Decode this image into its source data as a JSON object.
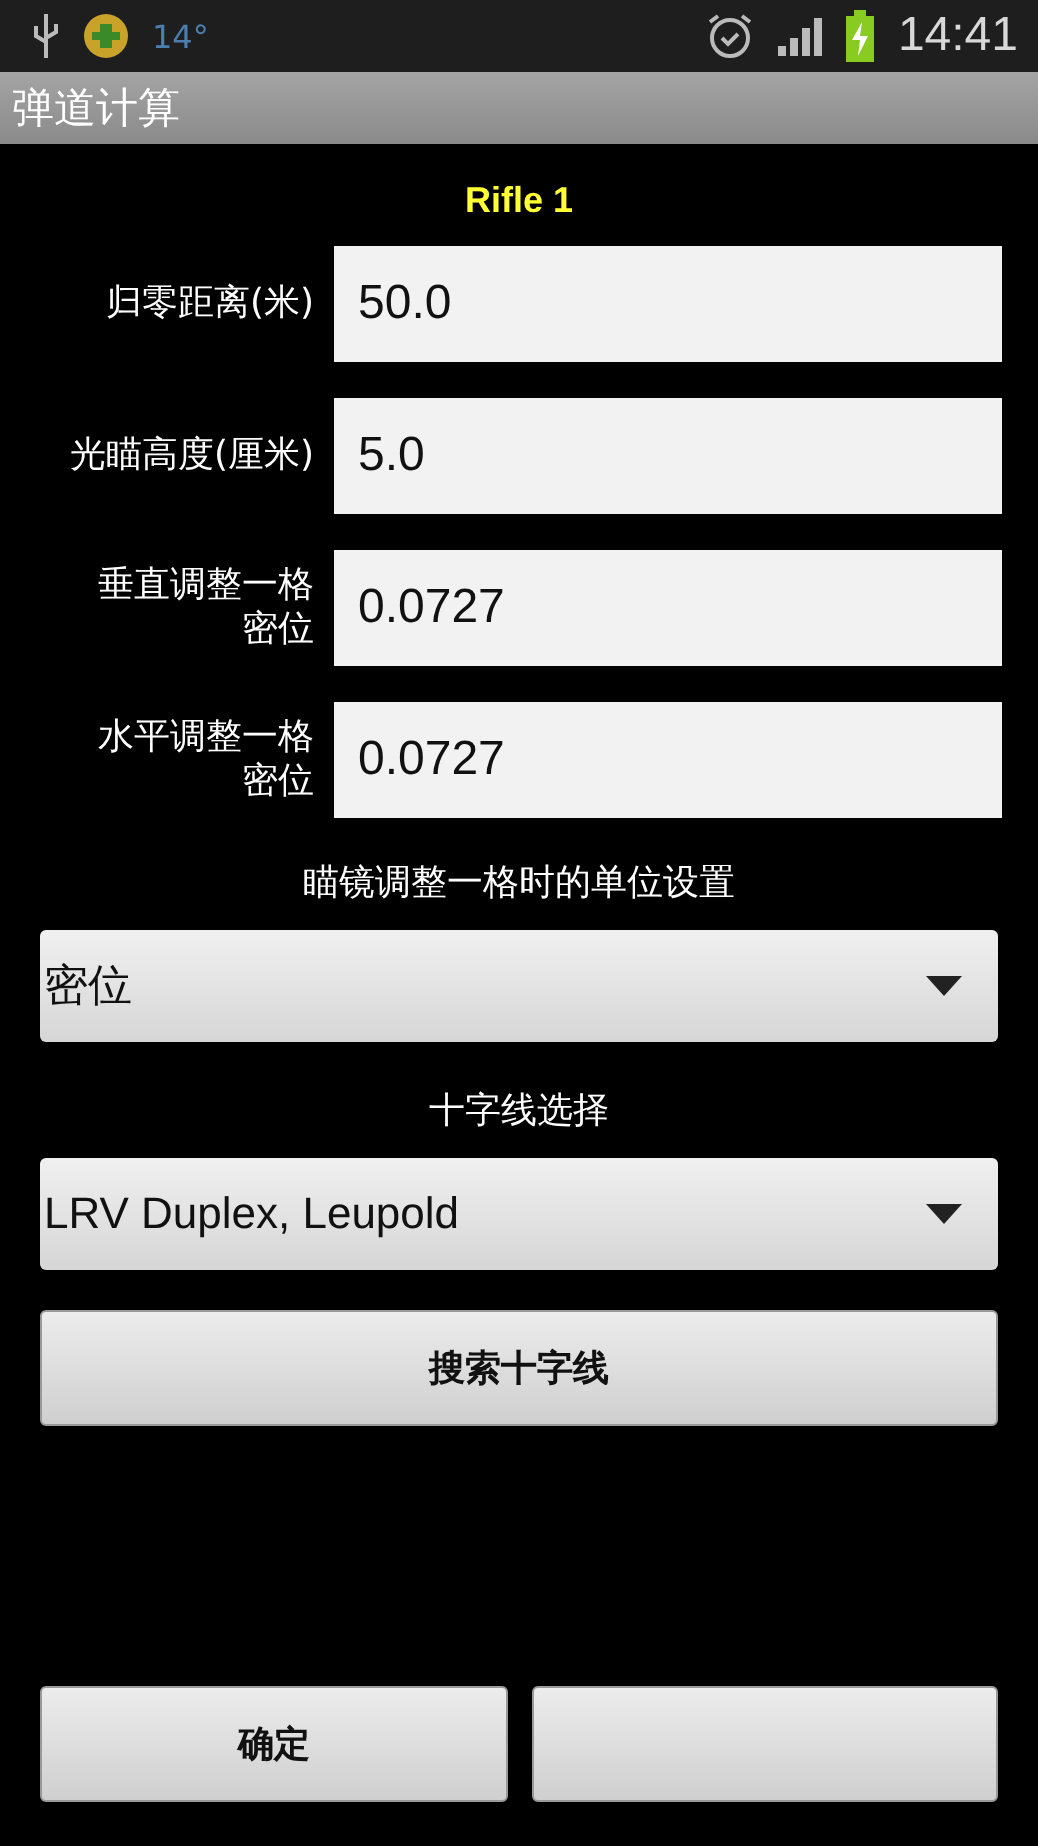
{
  "status_bar": {
    "time": "14:41",
    "notification_text": "14°"
  },
  "title": "弹道计算",
  "profile": "Rifle 1",
  "fields": [
    {
      "label": "归零距离(米)",
      "value": "50.0"
    },
    {
      "label": "光瞄高度(厘米)",
      "value": "5.0"
    },
    {
      "label": "垂直调整一格密位",
      "value": "0.0727"
    },
    {
      "label": "水平调整一格密位",
      "value": "0.0727"
    }
  ],
  "unit_label": "瞄镜调整一格时的单位设置",
  "unit_dropdown": {
    "value": "密位"
  },
  "reticle_label": "十字线选择",
  "reticle_dropdown": {
    "value": "LRV Duplex, Leupold"
  },
  "search_button": "搜索十字线",
  "buttons": [
    {
      "kind": "labeled",
      "label": "确定"
    },
    {
      "kind": "blank"
    }
  ]
}
